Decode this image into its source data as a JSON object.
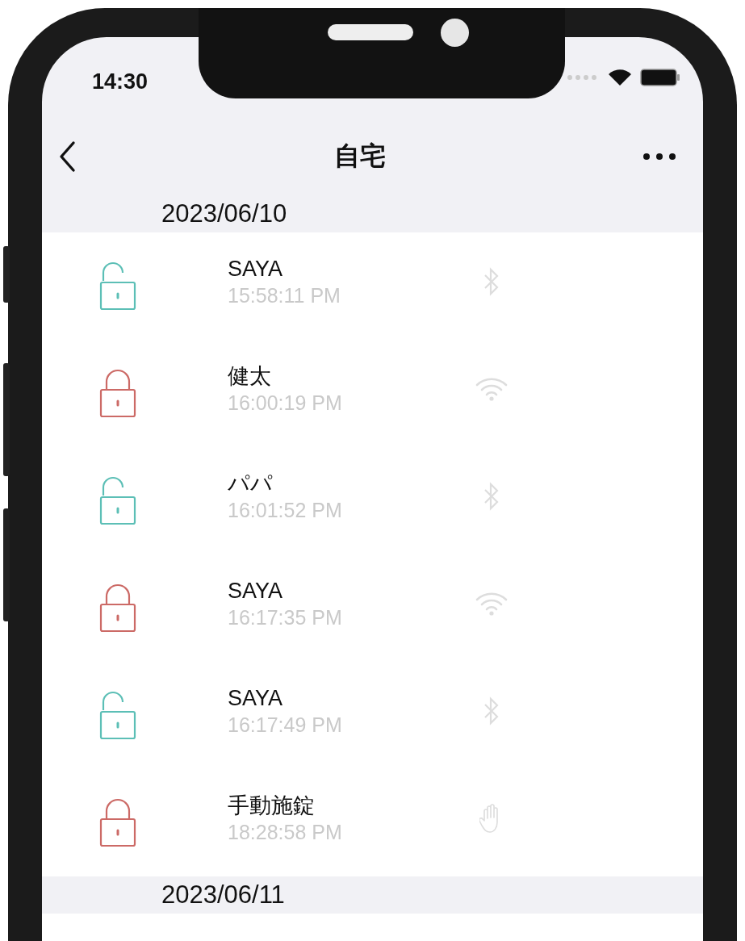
{
  "status_bar": {
    "time": "14:30"
  },
  "nav": {
    "title": "自宅"
  },
  "sections": [
    {
      "date": "2023/06/10",
      "entries": [
        {
          "name": "SAYA",
          "time": "15:58:11 PM",
          "kind": "unlock",
          "method": {
            "kind": "bluetooth"
          }
        },
        {
          "name": "健太",
          "time": "16:00:19 PM",
          "kind": "lock",
          "method": {
            "kind": "wifi"
          }
        },
        {
          "name": "パパ",
          "time": "16:01:52 PM",
          "kind": "unlock",
          "method": {
            "kind": "bluetooth"
          }
        },
        {
          "name": "SAYA",
          "time": "16:17:35 PM",
          "kind": "lock",
          "method": {
            "kind": "wifi"
          }
        },
        {
          "name": "SAYA",
          "time": "16:17:49 PM",
          "kind": "unlock",
          "method": {
            "kind": "bluetooth"
          }
        },
        {
          "name": "手動施錠",
          "time": "18:28:58 PM",
          "kind": "lock",
          "method": {
            "kind": "hand"
          }
        }
      ]
    },
    {
      "date": "2023/06/11"
    }
  ]
}
